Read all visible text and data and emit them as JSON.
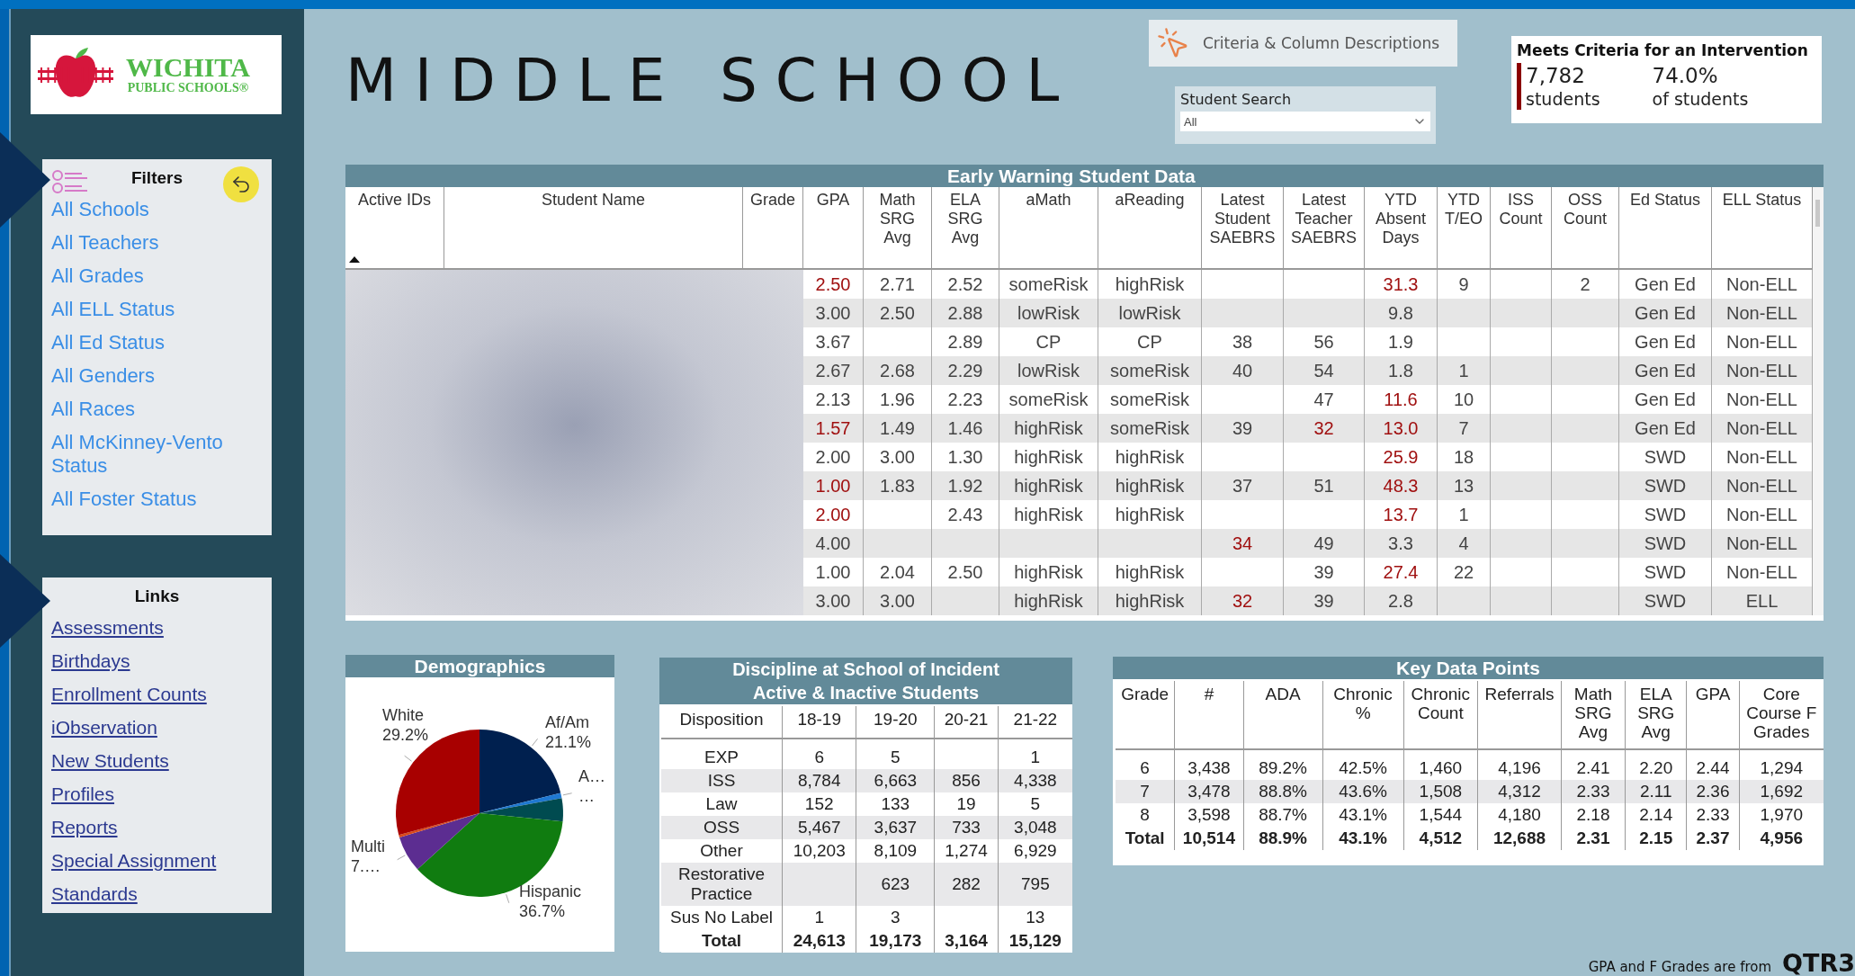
{
  "sidebar": {
    "logo": {
      "name": "WICHITA",
      "subtitle": "PUBLIC SCHOOLS®"
    },
    "filters": {
      "title": "Filters",
      "items": [
        "All Schools",
        "All Teachers",
        "All Grades",
        "All ELL Status",
        "All Ed Status",
        "All Genders",
        "All Races",
        "All McKinney-Vento Status",
        "All Foster Status"
      ]
    },
    "links": {
      "title": "Links",
      "items": [
        "Assessments",
        "Birthdays",
        "Enrollment Counts",
        "iObservation",
        "New Students",
        "Profiles",
        "Reports",
        "Special Assignment",
        "Standards"
      ]
    }
  },
  "header": {
    "title": "MIDDLE SCHOOL",
    "criteria_button": "Criteria & Column Descriptions",
    "student_search": {
      "label": "Student Search",
      "value": "All"
    },
    "intervention_card": {
      "title": "Meets Criteria for an Intervention",
      "count": "7,782",
      "count_label": "students",
      "percent": "74.0%",
      "percent_label": "of students"
    }
  },
  "early_warning": {
    "title": "Early Warning Student Data",
    "columns": [
      "Active IDs",
      "Student Name",
      "Grade",
      "GPA",
      "Math SRG Avg",
      "ELA SRG Avg",
      "aMath",
      "aReading",
      "Latest Student SAEBRS",
      "Latest Teacher SAEBRS",
      "YTD Absent Days",
      "YTD T/EO",
      "ISS Count",
      "OSS Count",
      "Ed Status",
      "ELL Status"
    ],
    "rows": [
      {
        "cells": [
          null,
          null,
          null,
          {
            "text": "2.50",
            "alert": true
          },
          {
            "text": "2.71",
            "alert": false
          },
          {
            "text": "2.52",
            "alert": false
          },
          {
            "text": "someRisk",
            "alert": false
          },
          {
            "text": "highRisk",
            "alert": false
          },
          null,
          null,
          {
            "text": "31.3",
            "alert": true
          },
          {
            "text": "9",
            "alert": false
          },
          null,
          {
            "text": "2",
            "alert": false
          },
          {
            "text": "Gen Ed",
            "alert": false
          },
          {
            "text": "Non-ELL",
            "alert": false
          }
        ]
      },
      {
        "cells": [
          null,
          null,
          null,
          {
            "text": "3.00",
            "alert": false
          },
          {
            "text": "2.50",
            "alert": false
          },
          {
            "text": "2.88",
            "alert": false
          },
          {
            "text": "lowRisk",
            "alert": false
          },
          {
            "text": "lowRisk",
            "alert": false
          },
          null,
          null,
          {
            "text": "9.8",
            "alert": false
          },
          null,
          null,
          null,
          {
            "text": "Gen Ed",
            "alert": false
          },
          {
            "text": "Non-ELL",
            "alert": false
          }
        ]
      },
      {
        "cells": [
          null,
          null,
          null,
          {
            "text": "3.67",
            "alert": false
          },
          null,
          {
            "text": "2.89",
            "alert": false
          },
          {
            "text": "CP",
            "alert": false
          },
          {
            "text": "CP",
            "alert": false
          },
          {
            "text": "38",
            "alert": false
          },
          {
            "text": "56",
            "alert": false
          },
          {
            "text": "1.9",
            "alert": false
          },
          null,
          null,
          null,
          {
            "text": "Gen Ed",
            "alert": false
          },
          {
            "text": "Non-ELL",
            "alert": false
          }
        ]
      },
      {
        "cells": [
          null,
          null,
          null,
          {
            "text": "2.67",
            "alert": false
          },
          {
            "text": "2.68",
            "alert": false
          },
          {
            "text": "2.29",
            "alert": false
          },
          {
            "text": "lowRisk",
            "alert": false
          },
          {
            "text": "someRisk",
            "alert": false
          },
          {
            "text": "40",
            "alert": false
          },
          {
            "text": "54",
            "alert": false
          },
          {
            "text": "1.8",
            "alert": false
          },
          {
            "text": "1",
            "alert": false
          },
          null,
          null,
          {
            "text": "Gen Ed",
            "alert": false
          },
          {
            "text": "Non-ELL",
            "alert": false
          }
        ]
      },
      {
        "cells": [
          null,
          null,
          null,
          {
            "text": "2.13",
            "alert": false
          },
          {
            "text": "1.96",
            "alert": false
          },
          {
            "text": "2.23",
            "alert": false
          },
          {
            "text": "someRisk",
            "alert": false
          },
          {
            "text": "someRisk",
            "alert": false
          },
          null,
          {
            "text": "47",
            "alert": false
          },
          {
            "text": "11.6",
            "alert": true
          },
          {
            "text": "10",
            "alert": false
          },
          null,
          null,
          {
            "text": "Gen Ed",
            "alert": false
          },
          {
            "text": "Non-ELL",
            "alert": false
          }
        ]
      },
      {
        "cells": [
          null,
          null,
          null,
          {
            "text": "1.57",
            "alert": true
          },
          {
            "text": "1.49",
            "alert": false
          },
          {
            "text": "1.46",
            "alert": false
          },
          {
            "text": "highRisk",
            "alert": false
          },
          {
            "text": "someRisk",
            "alert": false
          },
          {
            "text": "39",
            "alert": false
          },
          {
            "text": "32",
            "alert": true
          },
          {
            "text": "13.0",
            "alert": true
          },
          {
            "text": "7",
            "alert": false
          },
          null,
          null,
          {
            "text": "Gen Ed",
            "alert": false
          },
          {
            "text": "Non-ELL",
            "alert": false
          }
        ]
      },
      {
        "cells": [
          null,
          null,
          null,
          {
            "text": "2.00",
            "alert": false
          },
          {
            "text": "3.00",
            "alert": false
          },
          {
            "text": "1.30",
            "alert": false
          },
          {
            "text": "highRisk",
            "alert": false
          },
          {
            "text": "highRisk",
            "alert": false
          },
          null,
          null,
          {
            "text": "25.9",
            "alert": true
          },
          {
            "text": "18",
            "alert": false
          },
          null,
          null,
          {
            "text": "SWD",
            "alert": false
          },
          {
            "text": "Non-ELL",
            "alert": false
          }
        ]
      },
      {
        "cells": [
          null,
          null,
          null,
          {
            "text": "1.00",
            "alert": true
          },
          {
            "text": "1.83",
            "alert": false
          },
          {
            "text": "1.92",
            "alert": false
          },
          {
            "text": "highRisk",
            "alert": false
          },
          {
            "text": "highRisk",
            "alert": false
          },
          {
            "text": "37",
            "alert": false
          },
          {
            "text": "51",
            "alert": false
          },
          {
            "text": "48.3",
            "alert": true
          },
          {
            "text": "13",
            "alert": false
          },
          null,
          null,
          {
            "text": "SWD",
            "alert": false
          },
          {
            "text": "Non-ELL",
            "alert": false
          }
        ]
      },
      {
        "cells": [
          null,
          null,
          null,
          {
            "text": "2.00",
            "alert": true
          },
          null,
          {
            "text": "2.43",
            "alert": false
          },
          {
            "text": "highRisk",
            "alert": false
          },
          {
            "text": "highRisk",
            "alert": false
          },
          null,
          null,
          {
            "text": "13.7",
            "alert": true
          },
          {
            "text": "1",
            "alert": false
          },
          null,
          null,
          {
            "text": "SWD",
            "alert": false
          },
          {
            "text": "Non-ELL",
            "alert": false
          }
        ]
      },
      {
        "cells": [
          null,
          null,
          null,
          {
            "text": "4.00",
            "alert": false
          },
          null,
          null,
          null,
          null,
          {
            "text": "34",
            "alert": true
          },
          {
            "text": "49",
            "alert": false
          },
          {
            "text": "3.3",
            "alert": false
          },
          {
            "text": "4",
            "alert": false
          },
          null,
          null,
          {
            "text": "SWD",
            "alert": false
          },
          {
            "text": "Non-ELL",
            "alert": false
          }
        ]
      },
      {
        "cells": [
          null,
          null,
          null,
          {
            "text": "1.00",
            "alert": false
          },
          {
            "text": "2.04",
            "alert": false
          },
          {
            "text": "2.50",
            "alert": false
          },
          {
            "text": "highRisk",
            "alert": false
          },
          {
            "text": "highRisk",
            "alert": false
          },
          null,
          {
            "text": "39",
            "alert": false
          },
          {
            "text": "27.4",
            "alert": true
          },
          {
            "text": "22",
            "alert": false
          },
          null,
          null,
          {
            "text": "SWD",
            "alert": false
          },
          {
            "text": "Non-ELL",
            "alert": false
          }
        ]
      },
      {
        "cells": [
          null,
          null,
          null,
          {
            "text": "3.00",
            "alert": false
          },
          {
            "text": "3.00",
            "alert": false
          },
          null,
          {
            "text": "highRisk",
            "alert": false
          },
          {
            "text": "highRisk",
            "alert": false
          },
          {
            "text": "32",
            "alert": true
          },
          {
            "text": "39",
            "alert": false
          },
          {
            "text": "2.8",
            "alert": false
          },
          null,
          null,
          null,
          {
            "text": "SWD",
            "alert": false
          },
          {
            "text": "ELL",
            "alert": false
          }
        ]
      }
    ]
  },
  "demographics": {
    "title": "Demographics",
    "chart_data": {
      "type": "pie",
      "categories": [
        "Af/Am",
        "A…",
        null,
        "Hispanic",
        "Multi",
        null,
        "White"
      ],
      "values": [
        21.1,
        1.0,
        4.5,
        36.7,
        7.0,
        0.5,
        29.2
      ],
      "colors": [
        "#00204f",
        "#1f78d1",
        "#004b50",
        "#107c10",
        "#5c2d91",
        "#d84a1a",
        "#a80000"
      ],
      "value_labels": [
        "21.1%",
        "…",
        null,
        "36.7%",
        "7.…",
        null,
        "29.2%"
      ]
    }
  },
  "discipline": {
    "title": [
      "Discipline at School of Incident",
      "Active & Inactive Students"
    ],
    "columns": [
      "Disposition",
      "18-19",
      "19-20",
      "20-21",
      "21-22"
    ],
    "rows": [
      {
        "kind": "data",
        "cells": [
          "EXP",
          "6",
          "5",
          null,
          "1"
        ]
      },
      {
        "kind": "data",
        "cells": [
          "ISS",
          "8,784",
          "6,663",
          "856",
          "4,338"
        ]
      },
      {
        "kind": "data",
        "cells": [
          "Law",
          "152",
          "133",
          "19",
          "5"
        ]
      },
      {
        "kind": "data",
        "cells": [
          "OSS",
          "5,467",
          "3,637",
          "733",
          "3,048"
        ]
      },
      {
        "kind": "data",
        "cells": [
          "Other",
          "10,203",
          "8,109",
          "1,274",
          "6,929"
        ]
      },
      {
        "kind": "data",
        "cells": [
          "Restorative Practice",
          null,
          "623",
          "282",
          "795"
        ]
      },
      {
        "kind": "data",
        "cells": [
          "Sus No Label",
          "1",
          "3",
          null,
          "13"
        ]
      },
      {
        "kind": "total",
        "cells": [
          "Total",
          "24,613",
          "19,173",
          "3,164",
          "15,129"
        ]
      }
    ]
  },
  "key_data": {
    "title": "Key Data Points",
    "columns": [
      "Grade",
      "#",
      "ADA",
      "Chronic %",
      "Chronic Count",
      "Referrals",
      "Math SRG Avg",
      "ELA SRG Avg",
      "GPA",
      "Core Course F Grades"
    ],
    "rows": [
      {
        "kind": "data",
        "cells": [
          "6",
          "3,438",
          "89.2%",
          "42.5%",
          "1,460",
          "4,196",
          "2.41",
          "2.20",
          "2.44",
          "1,294"
        ]
      },
      {
        "kind": "data",
        "cells": [
          "7",
          "3,478",
          "88.8%",
          "43.6%",
          "1,508",
          "4,312",
          "2.33",
          "2.11",
          "2.36",
          "1,692"
        ]
      },
      {
        "kind": "data",
        "cells": [
          "8",
          "3,598",
          "88.7%",
          "43.1%",
          "1,544",
          "4,180",
          "2.18",
          "2.14",
          "2.33",
          "1,970"
        ]
      },
      {
        "kind": "total",
        "cells": [
          "Total",
          "10,514",
          "88.9%",
          "43.1%",
          "4,512",
          "12,688",
          "2.31",
          "2.15",
          "2.37",
          "4,956"
        ]
      }
    ]
  },
  "footer": {
    "note": "GPA and F Grades are from",
    "quarter": "QTR3"
  }
}
